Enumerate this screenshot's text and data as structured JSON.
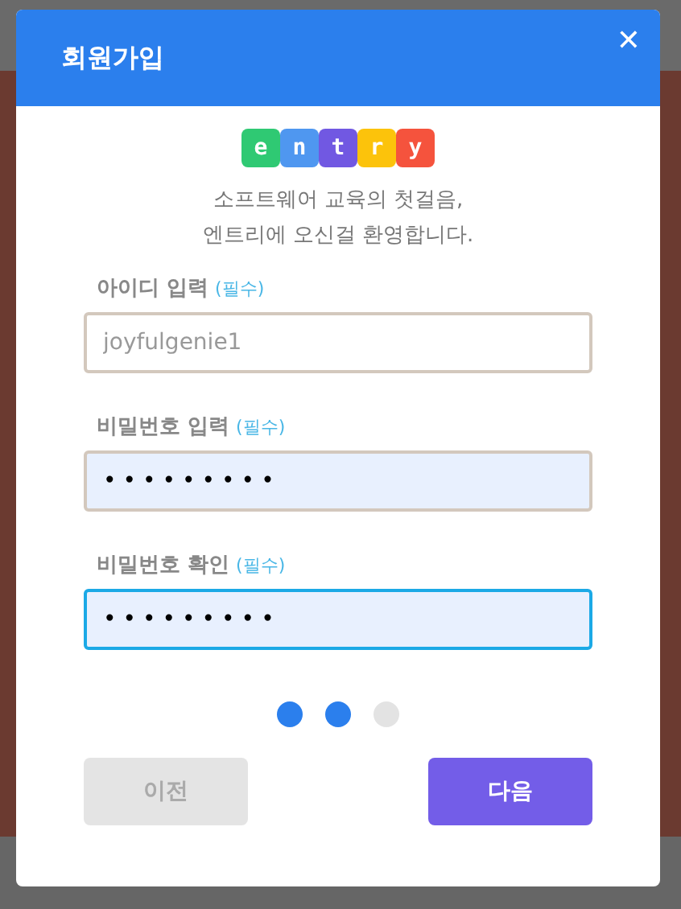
{
  "dialog": {
    "title": "회원가입",
    "close": "✕",
    "logo": [
      {
        "letter": "e",
        "color": "#2fc973"
      },
      {
        "letter": "n",
        "color": "#4f97f0"
      },
      {
        "letter": "t",
        "color": "#7158e2"
      },
      {
        "letter": "r",
        "color": "#fcc30b"
      },
      {
        "letter": "y",
        "color": "#f5533d"
      }
    ],
    "welcome": [
      "소프트웨어 교육의 첫걸음,",
      "엔트리에 오신걸 환영합니다."
    ],
    "fields": [
      {
        "label": "아이디 입력",
        "required": "(필수)",
        "value": "joyfulgenie1",
        "kind": "text",
        "focused": false
      },
      {
        "label": "비밀번호 입력",
        "required": "(필수)",
        "value": "•••••••••",
        "kind": "password",
        "focused": false
      },
      {
        "label": "비밀번호 확인",
        "required": "(필수)",
        "value": "•••••••••",
        "kind": "password",
        "focused": true
      }
    ],
    "steps": [
      {
        "selected": true
      },
      {
        "selected": true
      },
      {
        "selected": false
      }
    ],
    "buttons": [
      {
        "label": "이전",
        "disabled": true
      },
      {
        "label": "다음",
        "disabled": false
      }
    ]
  }
}
